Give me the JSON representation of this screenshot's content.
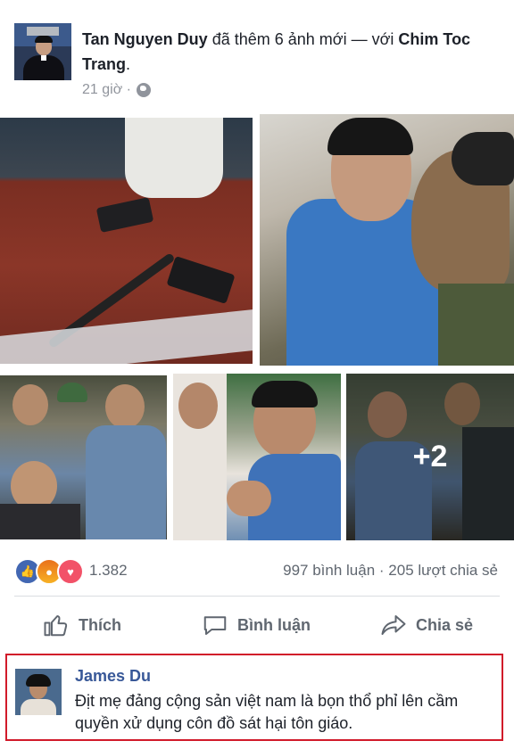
{
  "post": {
    "author": "Tan Nguyen Duy",
    "action_text": "đã thêm 6 ảnh mới — với",
    "tagged": "Chim Toc Trang",
    "tagged_suffix": ".",
    "time": "21 giờ ·",
    "privacy_icon": "globe-icon"
  },
  "gallery": {
    "more_overlay": "+2"
  },
  "engagement": {
    "reactions": [
      "like",
      "angry",
      "love"
    ],
    "reaction_count": "1.382",
    "comments": "997 bình luận",
    "separator": "·",
    "shares": "205 lượt chia sẻ"
  },
  "actions": {
    "like": "Thích",
    "comment": "Bình luận",
    "share": "Chia sẻ"
  },
  "comment": {
    "author": "James Du",
    "text": "Địt mẹ đảng cộng sản việt nam là bọn thổ phỉ lên cầm quyền xử dụng côn đồ sát hại tôn giáo."
  },
  "colors": {
    "link": "#385898",
    "muted": "#606770",
    "like_blue": "#4267b2",
    "highlight_border": "#d11a2a"
  }
}
